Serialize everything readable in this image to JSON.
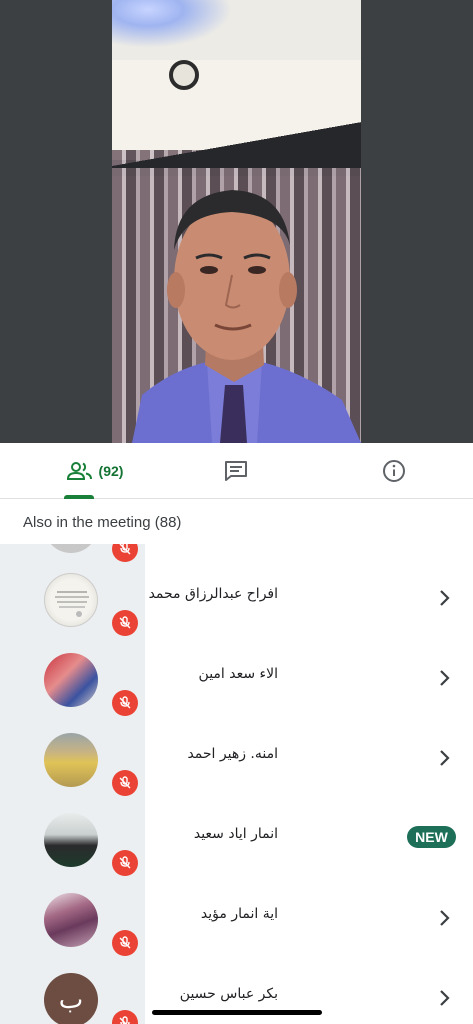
{
  "video": {
    "speaker": "self-video-feed"
  },
  "tabs": {
    "people": {
      "icon": "people-icon",
      "count": "(92)"
    },
    "chat": {
      "icon": "chat-icon"
    },
    "info": {
      "icon": "info-icon"
    }
  },
  "participants_header": "Also in the meeting (88)",
  "participants": [
    {
      "name": "",
      "avatar": "partial",
      "muted": true
    },
    {
      "name": "افراح عبدالرزاق محمد",
      "avatar": "text-image",
      "muted": true,
      "action": "chevron"
    },
    {
      "name": "الاء سعد امين",
      "avatar": "photo-red",
      "muted": true,
      "action": "chevron"
    },
    {
      "name": "امنه. زهير احمد",
      "avatar": "photo-yellow",
      "muted": true,
      "action": "chevron"
    },
    {
      "name": "انمار اياد سعيد",
      "avatar": "photo-man",
      "muted": true,
      "action": "new"
    },
    {
      "name": "اية انمار مؤيد",
      "avatar": "photo-purple",
      "muted": true,
      "action": "chevron"
    },
    {
      "name": "بكر عباس حسين",
      "avatar": "letter",
      "avatar_letter": "ب",
      "muted": true,
      "action": "chevron"
    }
  ],
  "new_badge_label": "NEW",
  "colors": {
    "accent": "#188038",
    "mute": "#ea4335",
    "new_badge": "#1e6f58"
  }
}
